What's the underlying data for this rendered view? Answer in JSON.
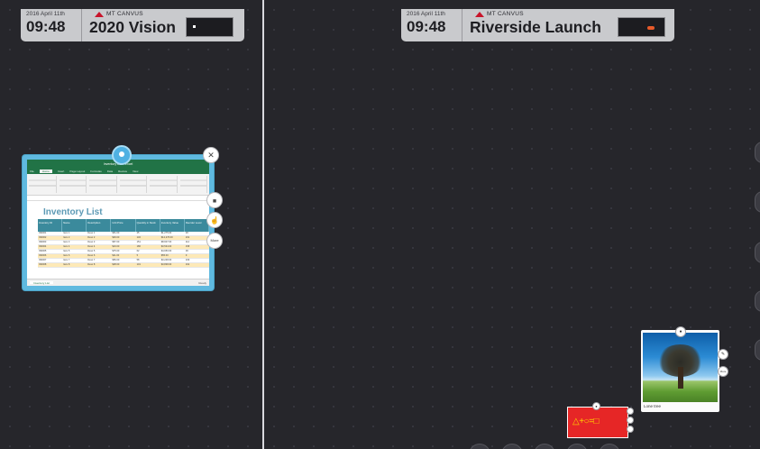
{
  "left_screen": {
    "date": "2016 April 11th",
    "time": "09:48",
    "brand": "MT CANVUS",
    "canvas_name": "2020 Vision"
  },
  "right_screen": {
    "date": "2016 April 11th",
    "time": "09:48",
    "brand": "MT CANVUS",
    "canvas_name": "Riverside Launch"
  },
  "excel_widget": {
    "window_title": "Inventory List - Excel",
    "tabs": [
      "File",
      "Home",
      "Insert",
      "Page Layout",
      "Formulas",
      "Data",
      "Review",
      "View"
    ],
    "active_tab": "Home",
    "sheet_title": "Inventory List",
    "columns": [
      "Inventory ID",
      "Name",
      "Description",
      "Unit Price",
      "Quantity in Stock",
      "Inventory Value",
      "Reorder Level"
    ],
    "rows": [
      [
        "IN0001",
        "Item 1",
        "Desc 1",
        "$51.00",
        "25",
        "$1,275.00",
        "29"
      ],
      [
        "IN0002",
        "Item 2",
        "Desc 2",
        "$93.00",
        "132",
        "$12,276.00",
        "231"
      ],
      [
        "IN0003",
        "Item 3",
        "Desc 3",
        "$57.00",
        "151",
        "$8,607.00",
        "114"
      ],
      [
        "IN0004",
        "Item 4",
        "Desc 4",
        "$19.00",
        "186",
        "$3,534.00",
        "158"
      ],
      [
        "IN0005",
        "Item 5",
        "Desc 5",
        "$75.00",
        "62",
        "$4,650.00",
        "39"
      ],
      [
        "IN0006",
        "Item 6",
        "Desc 6",
        "$11.00",
        "5",
        "$55.00",
        "9"
      ],
      [
        "IN0007",
        "Item 7",
        "Desc 7",
        "$56.00",
        "58",
        "$3,248.00",
        "109"
      ],
      [
        "IN0008",
        "Item 8",
        "Desc 8",
        "$38.00",
        "101",
        "$3,838.00",
        "162"
      ]
    ],
    "sheet_tab": "Inventory List",
    "status": "Ready"
  },
  "widget_controls": {
    "more_label": "More"
  },
  "photo_widget": {
    "caption": "Lone tree",
    "more_label": "More"
  },
  "sticky_note": {
    "text": "△+○=□"
  },
  "colors": {
    "canvas_bg": "#26262b",
    "header_bg": "#c9cacd",
    "excel_green": "#217346",
    "widget_frame": "#5fb9df",
    "note_red": "#e62626",
    "brand_red": "#c8142a"
  }
}
